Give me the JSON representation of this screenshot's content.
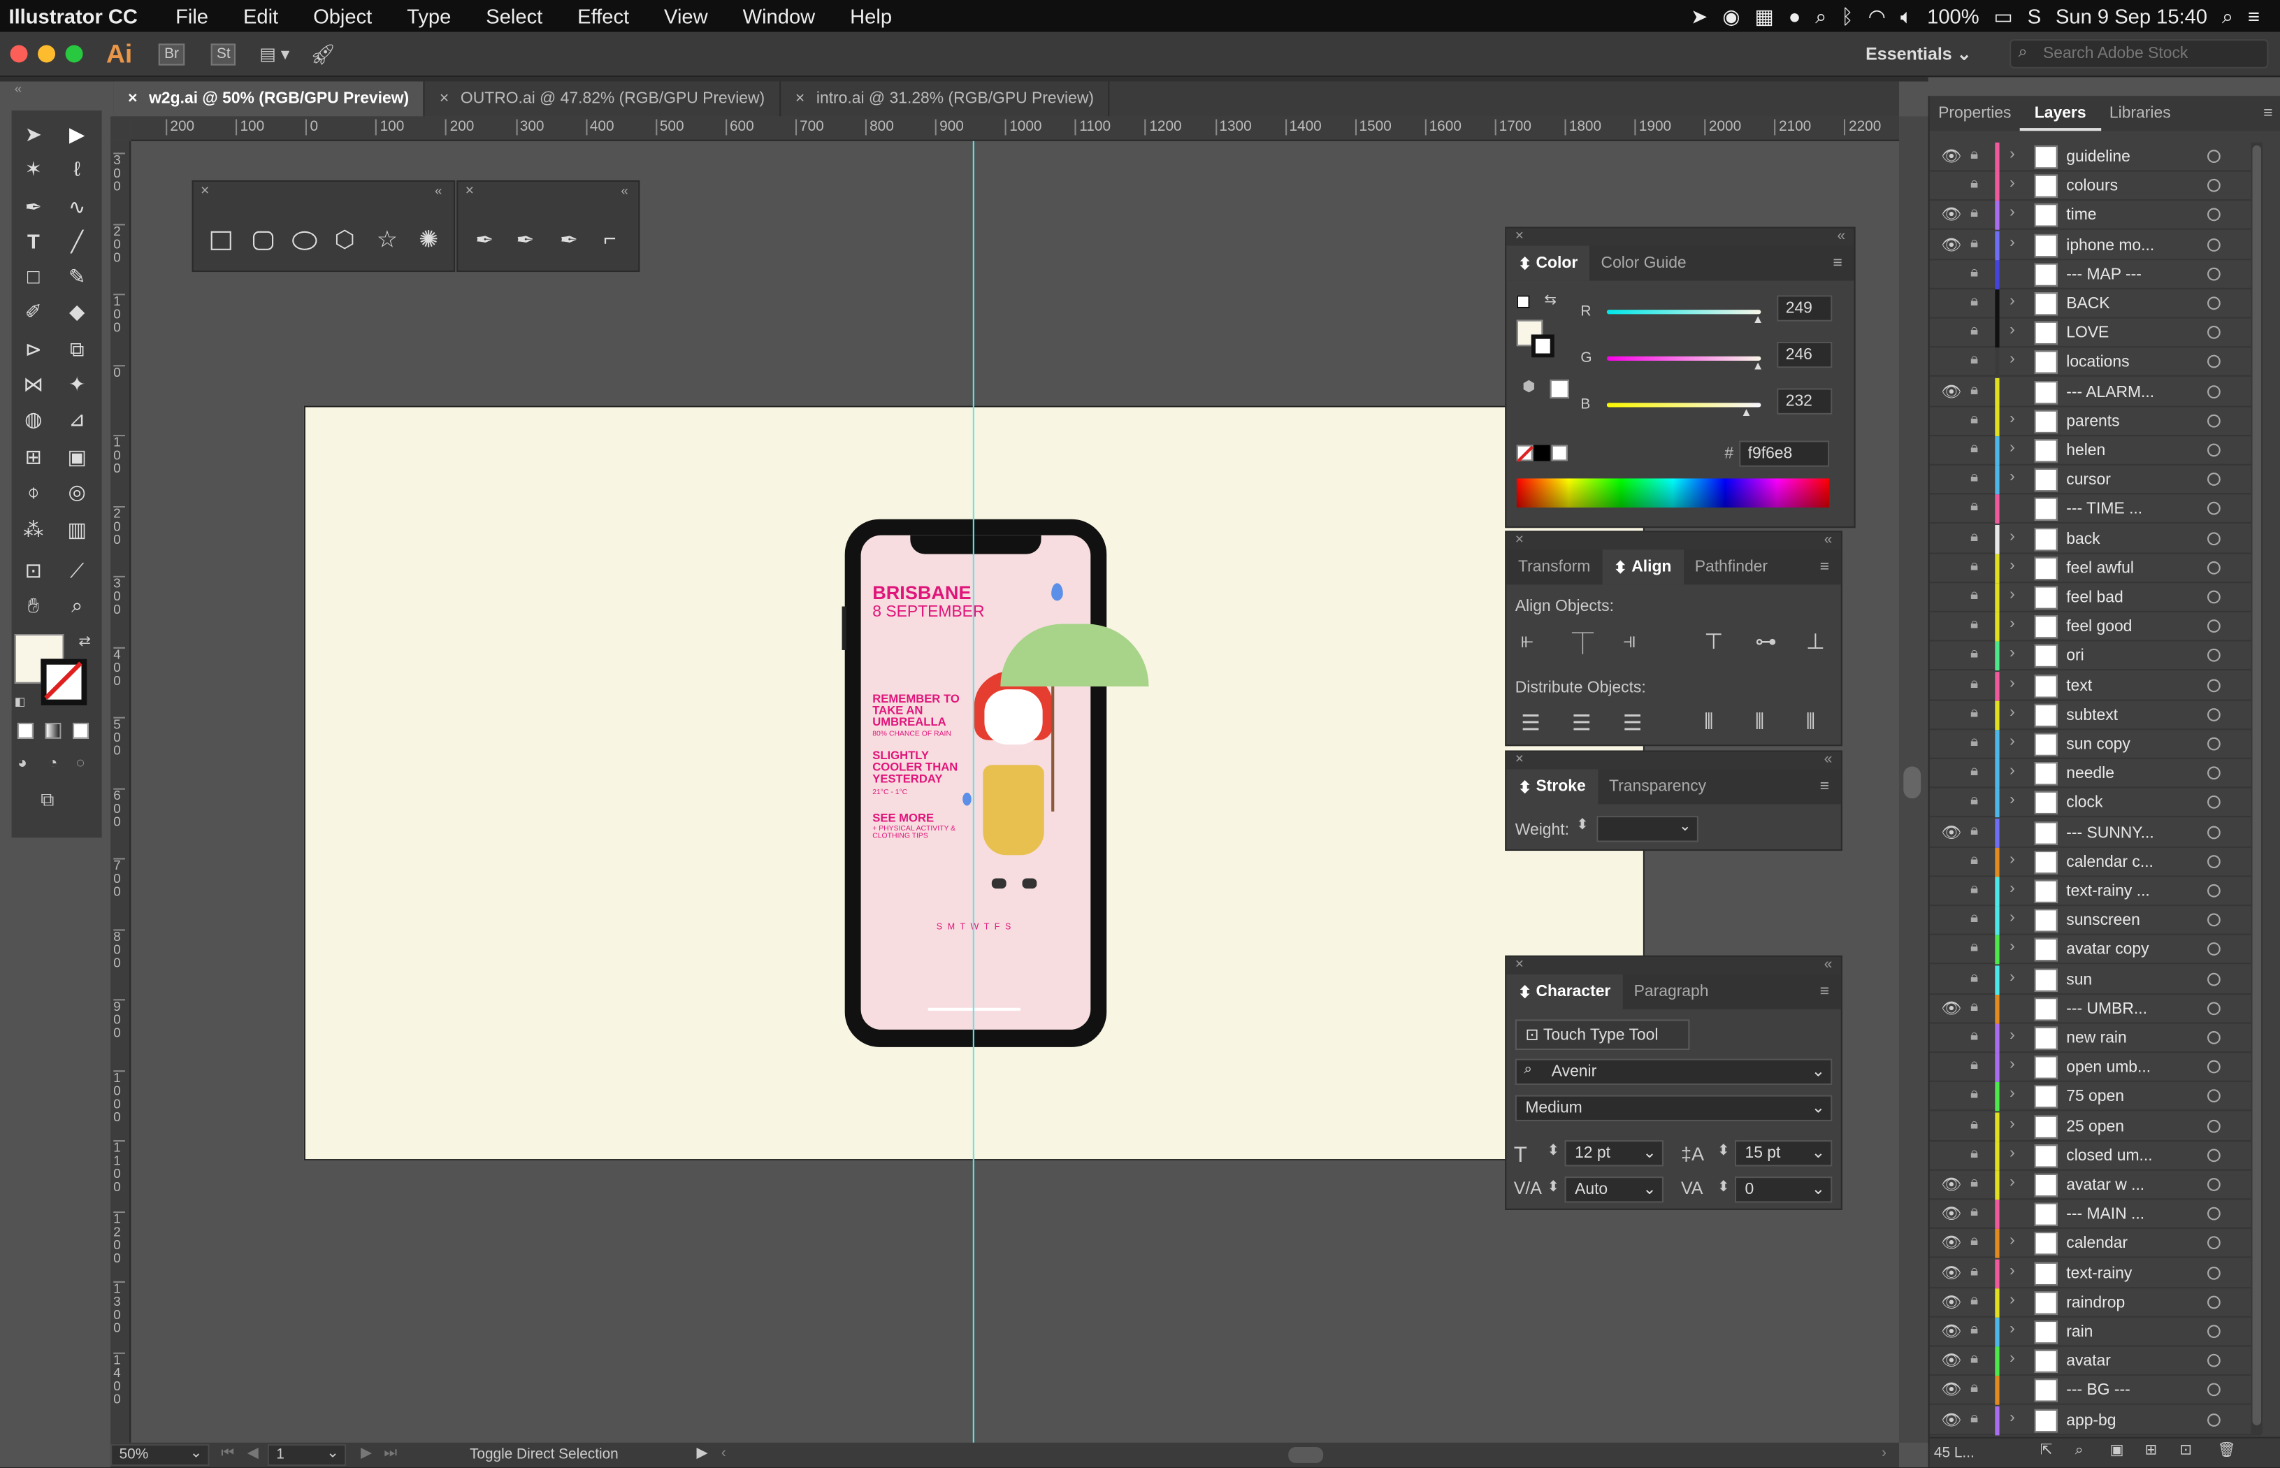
{
  "menubar": {
    "app_name": "Illustrator CC",
    "items": [
      "File",
      "Edit",
      "Object",
      "Type",
      "Select",
      "Effect",
      "View",
      "Window",
      "Help"
    ],
    "battery": "100%",
    "clock": "Sun 9 Sep  15:40"
  },
  "appbar": {
    "logo": "Ai",
    "bridge": "Br",
    "stock_btn": "St",
    "workspace": "Essentials",
    "search_placeholder": "Search Adobe Stock"
  },
  "tabs": [
    {
      "label": "w2g.ai @ 50% (RGB/GPU Preview)",
      "active": true
    },
    {
      "label": "OUTRO.ai @ 47.82% (RGB/GPU Preview)",
      "active": false
    },
    {
      "label": "intro.ai @ 31.28% (RGB/GPU Preview)",
      "active": false
    }
  ],
  "ruler": {
    "h_ticks": [
      "200",
      "100",
      "0",
      "100",
      "200",
      "300",
      "400",
      "500",
      "600",
      "700",
      "800",
      "900",
      "1000",
      "1100",
      "1200",
      "1300",
      "1400",
      "1500",
      "1600",
      "1700",
      "1800",
      "1900",
      "2000",
      "2100",
      "2200"
    ],
    "v_ticks": [
      "300",
      "200",
      "100",
      "0",
      "100",
      "200",
      "300",
      "400",
      "500",
      "600",
      "700",
      "800",
      "900",
      "1000",
      "1100",
      "1200",
      "1300",
      "1400"
    ]
  },
  "phone": {
    "city": "BRISBANE",
    "date": "8 SEPTEMBER",
    "msg1": "REMEMBER TO TAKE AN UMBREALLA",
    "msg1_sub": "80% CHANCE OF RAIN",
    "msg2": "SLIGHTLY COOLER THAN YESTERDAY",
    "msg2_sub": "21°C - 1°C",
    "msg3": "SEE MORE",
    "msg3_sub": "+ PHYSICAL ACTIVITY & CLOTHING TIPS",
    "days": "S M T W T F S"
  },
  "color_panel": {
    "tabs": [
      "Color",
      "Color Guide"
    ],
    "r_label": "R",
    "g_label": "G",
    "b_label": "B",
    "r": "249",
    "g": "246",
    "b": "232",
    "hex_label": "#",
    "hex": "f9f6e8",
    "fill_color": "#f9f6e8"
  },
  "align_panel": {
    "tabs": [
      "Transform",
      "Align",
      "Pathfinder"
    ],
    "align_objects": "Align Objects:",
    "distribute_objects": "Distribute Objects:"
  },
  "stroke_panel": {
    "tabs": [
      "Stroke",
      "Transparency"
    ],
    "weight_label": "Weight:"
  },
  "character_panel": {
    "tabs": [
      "Character",
      "Paragraph"
    ],
    "touch_type": "Touch Type Tool",
    "font": "Avenir",
    "style": "Medium",
    "size": "12 pt",
    "leading": "15 pt",
    "kerning": "Auto",
    "tracking": "0"
  },
  "layers_panel": {
    "tabs": [
      "Properties",
      "Layers",
      "Libraries"
    ],
    "count": "45 L...",
    "layers": [
      {
        "name": "guideline",
        "visible": true,
        "color": "#f05a9d"
      },
      {
        "name": "colours",
        "visible": false,
        "color": "#f05a9d"
      },
      {
        "name": "time",
        "visible": true,
        "color": "#a96ef0"
      },
      {
        "name": "iphone mo...",
        "visible": true,
        "color": "#6f6ef5"
      },
      {
        "name": "--- MAP ---",
        "visible": false,
        "color": "#4444dd"
      },
      {
        "name": "BACK",
        "visible": false,
        "color": "#111111"
      },
      {
        "name": "LOVE",
        "visible": false,
        "color": "#111111"
      },
      {
        "name": "locations",
        "visible": false,
        "color": "#3b3b3b"
      },
      {
        "name": "--- ALARM...",
        "visible": true,
        "color": "#e0e020"
      },
      {
        "name": "parents",
        "visible": false,
        "color": "#e0e020"
      },
      {
        "name": "helen",
        "visible": false,
        "color": "#4cb7e8"
      },
      {
        "name": "cursor",
        "visible": false,
        "color": "#4cb7e8"
      },
      {
        "name": "--- TIME ...",
        "visible": false,
        "color": "#f05a9d"
      },
      {
        "name": "back",
        "visible": false,
        "color": "#e8e8e8"
      },
      {
        "name": "feel awful",
        "visible": false,
        "color": "#e0e020"
      },
      {
        "name": "feel bad",
        "visible": false,
        "color": "#e0e020"
      },
      {
        "name": "feel good",
        "visible": false,
        "color": "#e0e020"
      },
      {
        "name": "ori",
        "visible": false,
        "color": "#4ce88a"
      },
      {
        "name": "text",
        "visible": false,
        "color": "#f05a9d"
      },
      {
        "name": "subtext",
        "visible": false,
        "color": "#e0e020"
      },
      {
        "name": "sun copy",
        "visible": false,
        "color": "#4cb7e8"
      },
      {
        "name": "needle",
        "visible": false,
        "color": "#4cb7e8"
      },
      {
        "name": "clock",
        "visible": false,
        "color": "#4cb7e8"
      },
      {
        "name": "--- SUNNY...",
        "visible": true,
        "color": "#6f6ef5"
      },
      {
        "name": "calendar c...",
        "visible": false,
        "color": "#e08a20"
      },
      {
        "name": "text-rainy ...",
        "visible": false,
        "color": "#4ce8e8"
      },
      {
        "name": "sunscreen",
        "visible": false,
        "color": "#4ce8e8"
      },
      {
        "name": "avatar copy",
        "visible": false,
        "color": "#4ce84c"
      },
      {
        "name": "sun",
        "visible": false,
        "color": "#4ce8e8"
      },
      {
        "name": "--- UMBR...",
        "visible": true,
        "color": "#e08a20"
      },
      {
        "name": "new rain",
        "visible": false,
        "color": "#a96ef0"
      },
      {
        "name": "open umb...",
        "visible": false,
        "color": "#a96ef0"
      },
      {
        "name": "75 open",
        "visible": false,
        "color": "#4ce84c"
      },
      {
        "name": "25 open",
        "visible": false,
        "color": "#e0e020"
      },
      {
        "name": "closed um...",
        "visible": false,
        "color": "#e0e020"
      },
      {
        "name": "avatar w ...",
        "visible": true,
        "color": "#e0e020"
      },
      {
        "name": "--- MAIN ...",
        "visible": true,
        "color": "#f05a9d"
      },
      {
        "name": "calendar",
        "visible": true,
        "color": "#e08a20"
      },
      {
        "name": "text-rainy",
        "visible": true,
        "color": "#f05a9d"
      },
      {
        "name": "raindrop",
        "visible": true,
        "color": "#e0e020"
      },
      {
        "name": "rain",
        "visible": true,
        "color": "#4cb7e8"
      },
      {
        "name": "avatar",
        "visible": true,
        "color": "#4ce84c"
      },
      {
        "name": "--- BG ---",
        "visible": true,
        "color": "#e08a20"
      },
      {
        "name": "app-bg",
        "visible": true,
        "color": "#a96ef0"
      }
    ]
  },
  "status": {
    "zoom": "50%",
    "page": "1",
    "tool_hint": "Toggle Direct Selection"
  }
}
